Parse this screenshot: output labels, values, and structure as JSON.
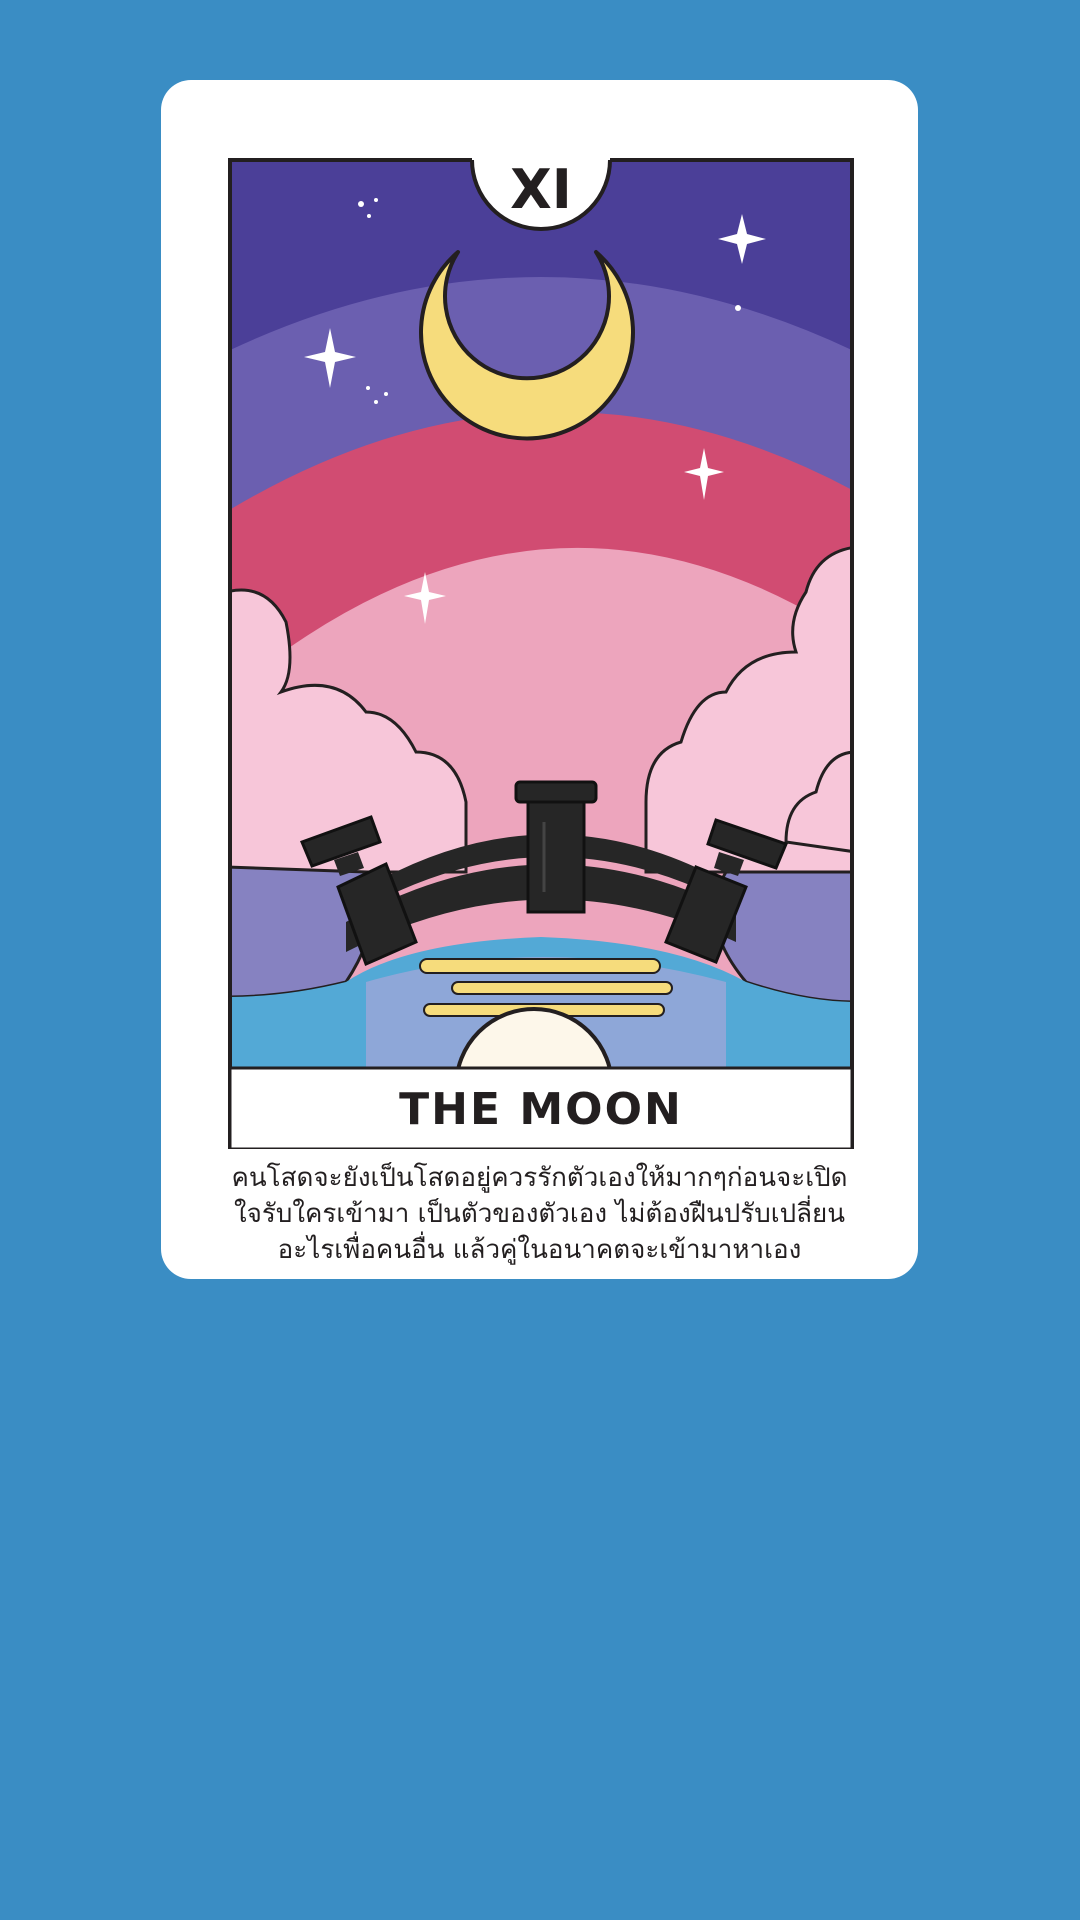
{
  "card": {
    "number": "XI",
    "title": "THE MOON",
    "description_lines": [
      "คนโสดจะยังเป็นโสดอยู่ควรรักตัวเองให้มากๆก่อนจะเปิด",
      "ใจรับใครเข้ามา เป็นตัวของตัวเอง ไม่ต้องฝืนปรับเปลี่ยน",
      "อะไรเพื่อคนอื่น แล้วคู่ในอนาคตจะเข้ามาหาเอง"
    ]
  },
  "colors": {
    "background": "#3a8dc4",
    "card": "#ffffff",
    "sky_top": "#4b3f98",
    "sky_band": "#6b5fb0",
    "sky_red": "#d14c72",
    "sky_pink": "#eda5bd",
    "cloud": "#f7c6d9",
    "moon": "#f6dc7c",
    "bridge": "#262626",
    "water": "#53a9d6",
    "text": "#231f20"
  }
}
